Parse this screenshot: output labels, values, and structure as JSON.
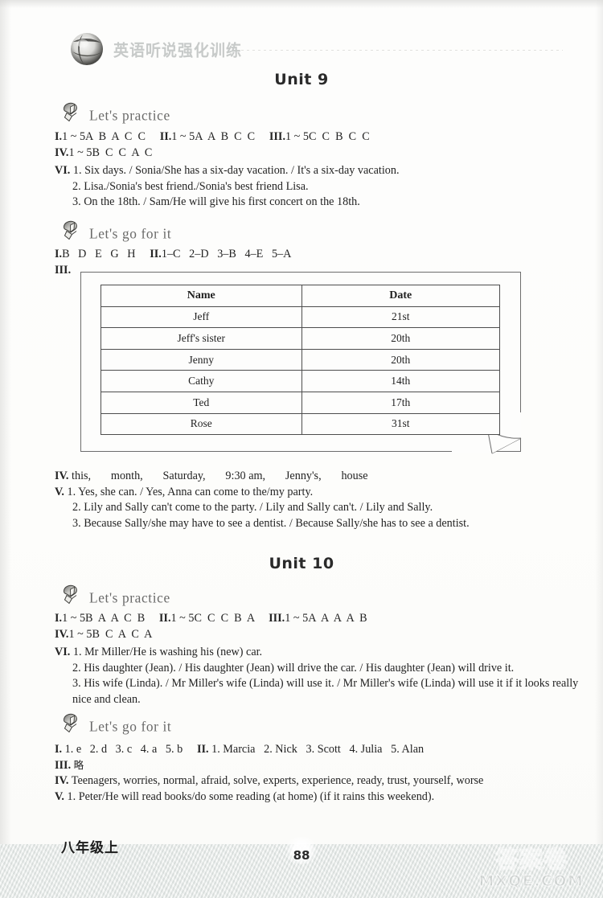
{
  "masthead": {
    "title": "英语听说强化训练",
    "logo_icon": "globe-icon"
  },
  "units": [
    {
      "title": "Unit 9",
      "sections": [
        {
          "heading": "Let's practice",
          "heading_icon": "speaker-icon",
          "lines": [
            {
              "roman": "I.",
              "text": "1 ~ 5A  B  A  C  C",
              "tail": "",
              "indent": false
            },
            {
              "roman": "VI.",
              "text": "1. Six days. / Sonia/She has a six-day vacation. / It's a six-day vacation.",
              "indent": false
            }
          ],
          "answers_row1": [
            {
              "roman": "I.",
              "text": "1 ~ 5A  B  A  C  C"
            },
            {
              "roman": "II.",
              "text": "1 ~ 5A  A  B  C  C"
            },
            {
              "roman": "III.",
              "text": "1 ~ 5C  C  B  C  C"
            }
          ],
          "answers_row2": {
            "roman": "IV.",
            "text": "1 ~ 5B  C  C  A  C"
          },
          "vi_label": "VI.",
          "vi_items": [
            "1. Six days. / Sonia/She has a six-day vacation. / It's a six-day vacation.",
            "2. Lisa./Sonia's best friend./Sonia's best friend Lisa.",
            "3. On the 18th. / Sam/He will give his first concert on the 18th."
          ]
        },
        {
          "heading": "Let's go for it",
          "heading_icon": "speaker-icon",
          "row1": [
            {
              "roman": "I.",
              "text": "B   D   E   G   H"
            },
            {
              "roman": "II.",
              "text": "1–C   2–D   3–B   4–E   5–A"
            }
          ],
          "row2_label": "III.",
          "table": {
            "columns": [
              "Name",
              "Date"
            ],
            "rows": [
              [
                "Jeff",
                "21st"
              ],
              [
                "Jeff's sister",
                "20th"
              ],
              [
                "Jenny",
                "20th"
              ],
              [
                "Cathy",
                "14th"
              ],
              [
                "Ted",
                "17th"
              ],
              [
                "Rose",
                "31st"
              ]
            ]
          },
          "iv_label": "IV.",
          "iv_text": "this,       month,       Saturday,       9:30 am,       Jenny's,       house",
          "v_label": "V.",
          "v_items": [
            "1. Yes, she can. / Yes, Anna can come to the/my party.",
            "2. Lily and Sally can't come to the party. / Lily and Sally can't. / Lily and Sally.",
            "3. Because Sally/she may have to see a dentist. / Because Sally/she has to see a dentist."
          ]
        }
      ]
    },
    {
      "title": "Unit 10",
      "sections": [
        {
          "heading": "Let's practice",
          "heading_icon": "speaker-icon",
          "answers_row1": [
            {
              "roman": "I.",
              "text": "1 ~ 5B  A  A  C  B"
            },
            {
              "roman": "II.",
              "text": "1 ~ 5C  C  C  B  A"
            },
            {
              "roman": "III.",
              "text": "1 ~ 5A  A  A  A  B"
            }
          ],
          "answers_row2": {
            "roman": "IV.",
            "text": "1 ~ 5B  C  A  C  A"
          },
          "vi_label": "VI.",
          "vi_items": [
            "1. Mr Miller/He is washing his (new) car.",
            "2. His daughter (Jean). / His daughter (Jean) will drive the car. / His daughter (Jean) will drive it.",
            "3. His wife (Linda). / Mr Miller's wife (Linda) will use it. / Mr Miller's wife (Linda) will use it if it looks really nice and clean."
          ]
        },
        {
          "heading": "Let's go for it",
          "heading_icon": "speaker-icon",
          "row1": [
            {
              "roman": "I.",
              "text": "1. e   2. d   3. c   4. a   5. b"
            },
            {
              "roman": "II.",
              "text": "1. Marcia   2. Nick   3. Scott   4. Julia   5. Alan"
            }
          ],
          "iii_label": "III.",
          "iii_text": "略",
          "iv_label": "IV.",
          "iv_text": "Teenagers, worries, normal, afraid, solve, experts, experience, ready, trust, yourself, worse",
          "v_label": "V.",
          "v_items": [
            "1. Peter/He will read books/do some reading (at home) (if it rains this weekend)."
          ]
        }
      ]
    }
  ],
  "footer": {
    "grade": "八年级上",
    "page_number": "88"
  },
  "watermark": {
    "cn": "答案卷",
    "en": "MXQE.COM"
  }
}
